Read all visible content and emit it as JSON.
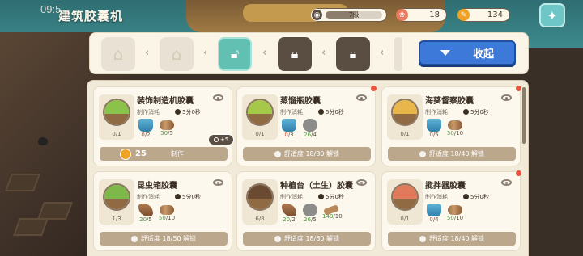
{
  "status": {
    "time": "09:5"
  },
  "header": {
    "title": "建筑胶囊机"
  },
  "resources": {
    "level": {
      "label": "7级",
      "progress": 0.5
    },
    "hearts": {
      "value": "18"
    },
    "coins": {
      "value": "134"
    }
  },
  "icons": {
    "settings": "wrench-icon",
    "blueprint_gray": "house-icon",
    "blueprint_teal": "lock-icon",
    "blueprint_dark": "lock-icon"
  },
  "strip": {
    "collapse_label": "收起"
  },
  "cards": [
    {
      "name": "装饰制造机胶囊",
      "cost_label": "制作消耗",
      "time": "5分0秒",
      "count": "0/1",
      "thumb_color": "#8bc34a",
      "mats": [
        {
          "kind": "blue",
          "have": "0",
          "need": "2",
          "ok": false
        },
        {
          "kind": "log",
          "have": "50",
          "need": "5",
          "ok": true
        }
      ],
      "action": {
        "type": "craft",
        "coin": "25",
        "label": "制作",
        "boost": "+5"
      },
      "dot": false
    },
    {
      "name": "蒸馏瓶胶囊",
      "cost_label": "制作消耗",
      "time": "5分0秒",
      "count": "0/1",
      "thumb_color": "#a5c84a",
      "mats": [
        {
          "kind": "blue",
          "have": "0",
          "need": "3",
          "ok": false
        },
        {
          "kind": "stone",
          "have": "26",
          "need": "4",
          "ok": true
        }
      ],
      "action": {
        "type": "unlock",
        "label": "舒适度 18/30 解锁"
      },
      "dot": true
    },
    {
      "name": "海葵督察胶囊",
      "cost_label": "制作消耗",
      "time": "5分0秒",
      "count": "0/1",
      "thumb_color": "#e8b64a",
      "mats": [
        {
          "kind": "blue",
          "have": "0",
          "need": "5",
          "ok": false
        },
        {
          "kind": "log",
          "have": "50",
          "need": "10",
          "ok": true
        }
      ],
      "action": {
        "type": "unlock",
        "label": "舒适度 18/40 解锁"
      },
      "dot": true
    },
    {
      "name": "昆虫箱胶囊",
      "cost_label": "制作消耗",
      "time": "5分0秒",
      "count": "1/3",
      "thumb_color": "#7fb84a",
      "mats": [
        {
          "kind": "root",
          "have": "20",
          "need": "5",
          "ok": true
        },
        {
          "kind": "log",
          "have": "50",
          "need": "10",
          "ok": true
        }
      ],
      "action": {
        "type": "unlock",
        "label": "舒适度 18/50 解锁"
      },
      "dot": false
    },
    {
      "name": "种植台（土生）胶囊",
      "cost_label": "制作消耗",
      "time": "5分0秒",
      "count": "6/8",
      "thumb_color": "#6a4a30",
      "mats": [
        {
          "kind": "root",
          "have": "20",
          "need": "2",
          "ok": true
        },
        {
          "kind": "stone",
          "have": "26",
          "need": "5",
          "ok": true
        },
        {
          "kind": "stick",
          "have": "148",
          "need": "10",
          "ok": true
        }
      ],
      "action": {
        "type": "unlock",
        "label": "舒适度 18/60 解锁"
      },
      "dot": false
    },
    {
      "name": "搅拌器胶囊",
      "cost_label": "制作消耗",
      "time": "5分0秒",
      "count": "0/1",
      "thumb_color": "#e07a5a",
      "mats": [
        {
          "kind": "blue",
          "have": "0",
          "need": "4",
          "ok": false
        },
        {
          "kind": "log",
          "have": "50",
          "need": "10",
          "ok": true
        }
      ],
      "action": {
        "type": "unlock",
        "label": "舒适度 18/40 解锁"
      },
      "dot": true
    }
  ]
}
